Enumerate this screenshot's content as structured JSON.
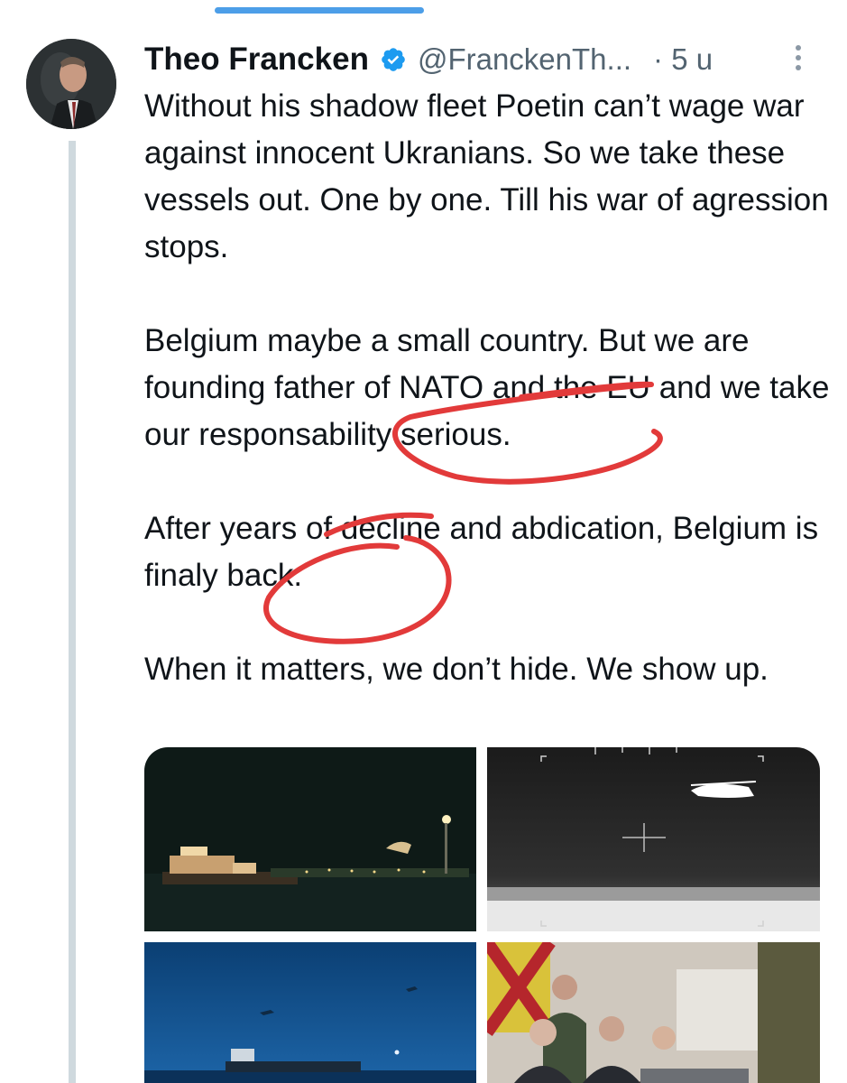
{
  "post": {
    "author_name": "Theo Francken",
    "author_handle": "@FranckenTh...",
    "time_ago": "· 5 u",
    "paragraphs": [
      "Without his shadow fleet Poetin can’t wage war against innocent Ukranians. So we take these vessels out. One by one. Till his war of agression stops.",
      "Belgium maybe a small country. But we are founding father of NATO and the EU and we take our responsability serious.",
      "After years of decline and abdication, Belgium is finaly back.",
      "When it matters, we don’t hide. We show up."
    ]
  },
  "colors": {
    "verified_badge": "#1d9bf0",
    "scribble": "#e23a3a",
    "thread_line": "#cfd9de",
    "handle_text": "#536471"
  },
  "icons": {
    "verified": "verified-badge-icon",
    "more": "more-options-icon"
  }
}
